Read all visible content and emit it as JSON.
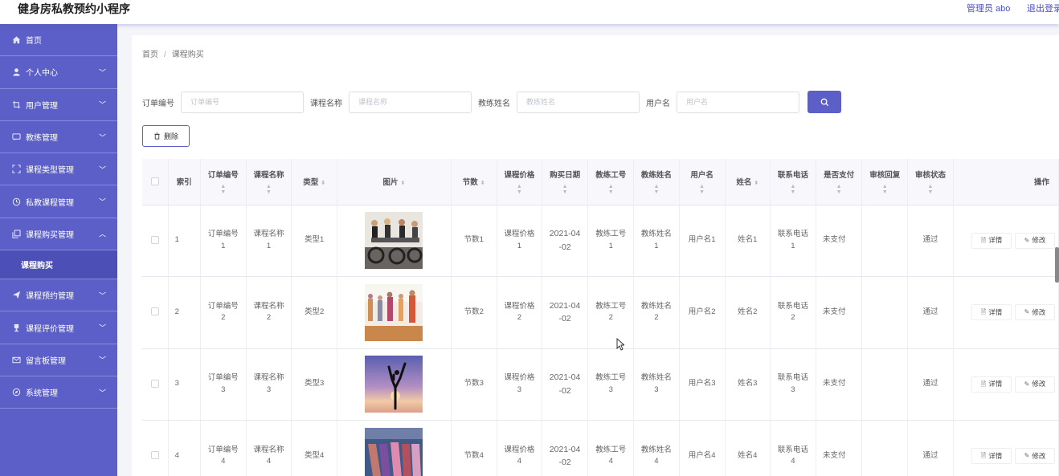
{
  "header": {
    "app_title": "健身房私教预约小程序",
    "admin_label": "管理员 abo",
    "logout_label": "退出登录"
  },
  "sidebar": {
    "items": [
      {
        "label": "首页",
        "icon": "home-icon",
        "expanded": null
      },
      {
        "label": "个人中心",
        "icon": "user-icon",
        "expanded": false
      },
      {
        "label": "用户管理",
        "icon": "frame-icon",
        "expanded": false
      },
      {
        "label": "教练管理",
        "icon": "chat-icon",
        "expanded": false
      },
      {
        "label": "课程类型管理",
        "icon": "expand-icon",
        "expanded": false
      },
      {
        "label": "私教课程管理",
        "icon": "clock-icon",
        "expanded": false
      },
      {
        "label": "课程购买管理",
        "icon": "copy-icon",
        "expanded": true
      },
      {
        "label": "课程预约管理",
        "icon": "send-icon",
        "expanded": false
      },
      {
        "label": "课程评价管理",
        "icon": "trophy-icon",
        "expanded": false
      },
      {
        "label": "留言板管理",
        "icon": "mail-icon",
        "expanded": false
      },
      {
        "label": "系统管理",
        "icon": "compass-icon",
        "expanded": false
      }
    ],
    "sub_item": "课程购买"
  },
  "breadcrumb": {
    "home": "首页",
    "separator": "/",
    "current": "课程购买"
  },
  "search": {
    "order_no_label": "订单编号",
    "order_no_placeholder": "订单编号",
    "course_name_label": "课程名称",
    "course_name_placeholder": "课程名称",
    "coach_name_label": "教练姓名",
    "coach_name_placeholder": "教练姓名",
    "username_label": "用户名",
    "username_placeholder": "用户名"
  },
  "toolbar": {
    "delete_label": "删除"
  },
  "table": {
    "headers": {
      "index": "索引",
      "order_no": "订单编号",
      "course_name": "课程名称",
      "type": "类型",
      "image": "图片",
      "sessions": "节数",
      "price": "课程价格",
      "buy_date": "购买日期",
      "coach_no": "教练工号",
      "coach_name": "教练姓名",
      "username": "用户名",
      "name": "姓名",
      "phone": "联系电话",
      "paid": "是否支付",
      "reply": "审核回复",
      "status": "审核状态",
      "actions": "操作"
    },
    "rows": [
      {
        "index": "1",
        "order_no": [
          "订单编号",
          "1"
        ],
        "course_name": [
          "课程名称",
          "1"
        ],
        "type": "类型1",
        "image": "photo-spin-class",
        "sessions": "节数1",
        "price": [
          "课程价格",
          "1"
        ],
        "buy_date": [
          "2021-04",
          "-02"
        ],
        "coach_no": [
          "教练工号",
          "1"
        ],
        "coach_name": [
          "教练姓名",
          "1"
        ],
        "username": "用户名1",
        "name": "姓名1",
        "phone": [
          "联系电话",
          "1"
        ],
        "paid": "未支付",
        "reply": "",
        "status": "通过",
        "detail": "详情",
        "edit": "修改"
      },
      {
        "index": "2",
        "order_no": [
          "订单编号",
          "2"
        ],
        "course_name": [
          "课程名称",
          "2"
        ],
        "type": "类型2",
        "image": "photo-gym-class",
        "sessions": "节数2",
        "price": [
          "课程价格",
          "2"
        ],
        "buy_date": [
          "2021-04",
          "-02"
        ],
        "coach_no": [
          "教练工号",
          "2"
        ],
        "coach_name": [
          "教练姓名",
          "2"
        ],
        "username": "用户名2",
        "name": "姓名2",
        "phone": [
          "联系电话",
          "2"
        ],
        "paid": "未支付",
        "reply": "",
        "status": "通过",
        "detail": "详情",
        "edit": "修改"
      },
      {
        "index": "3",
        "order_no": [
          "订单编号",
          "3"
        ],
        "course_name": [
          "课程名称",
          "3"
        ],
        "type": "类型3",
        "image": "photo-yoga-sunset",
        "sessions": "节数3",
        "price": [
          "课程价格",
          "3"
        ],
        "buy_date": [
          "2021-04",
          "-02"
        ],
        "coach_no": [
          "教练工号",
          "3"
        ],
        "coach_name": [
          "教练姓名",
          "3"
        ],
        "username": "用户名3",
        "name": "姓名3",
        "phone": [
          "联系电话",
          "3"
        ],
        "paid": "未支付",
        "reply": "",
        "status": "通过",
        "detail": "详情",
        "edit": "修改"
      },
      {
        "index": "4",
        "order_no": [
          "订单编号",
          "4"
        ],
        "course_name": [
          "课程名称",
          "4"
        ],
        "type": "类型4",
        "image": "photo-stretch-class",
        "sessions": "节数4",
        "price": [
          "课程价格",
          "4"
        ],
        "buy_date": [
          "2021-04",
          "-02"
        ],
        "coach_no": [
          "教练工号",
          "4"
        ],
        "coach_name": [
          "教练姓名",
          "4"
        ],
        "username": "用户名4",
        "name": "姓名4",
        "phone": [
          "联系电话",
          "4"
        ],
        "paid": "未支付",
        "reply": "",
        "status": "通过",
        "detail": "详情",
        "edit": "修改"
      }
    ]
  },
  "colors": {
    "accent": "#5b5fc7",
    "sidebar_sub": "#4c50b6"
  }
}
